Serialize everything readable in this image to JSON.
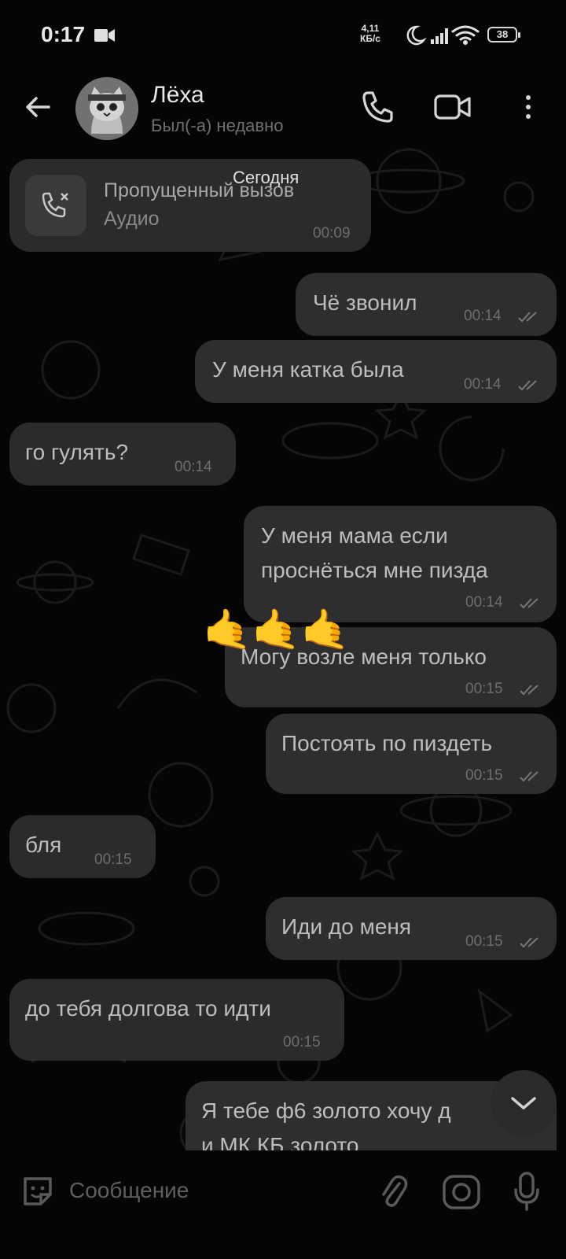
{
  "status_bar": {
    "time": "0:17",
    "net_speed_value": "4,11",
    "net_speed_unit": "КБ/с",
    "battery": "38",
    "icons": [
      "video-camera-icon",
      "moon-icon",
      "signal-icon",
      "wifi-icon",
      "battery-icon"
    ]
  },
  "header": {
    "name": "Лёха",
    "status": "Был(-а) недавно",
    "icons": [
      "back-arrow-icon",
      "phone-icon",
      "video-call-icon",
      "more-vertical-icon"
    ]
  },
  "date_separator": "Сегодня",
  "missed_call": {
    "title": "Пропущенный вызов",
    "subtitle": "Аудио",
    "time": "00:09"
  },
  "messages": [
    {
      "dir": "out",
      "text": "Чё звонил",
      "time": "00:14"
    },
    {
      "dir": "out",
      "text": "У меня катка была",
      "time": "00:14"
    },
    {
      "dir": "in",
      "text": "го гулять?",
      "time": "00:14"
    },
    {
      "dir": "out",
      "lines": [
        "У меня мама если",
        "проснёться мне пизда"
      ],
      "time": "00:14"
    },
    {
      "dir": "out",
      "text": "Могу возле меня только",
      "time": "00:15"
    },
    {
      "dir": "out",
      "text": "Постоять по пиздеть",
      "time": "00:15"
    },
    {
      "dir": "in",
      "text": "бля",
      "time": "00:15"
    },
    {
      "dir": "out",
      "text": "Иди до меня",
      "time": "00:15"
    },
    {
      "dir": "in",
      "text": "до тебя долгова то идти",
      "time": "00:15"
    },
    {
      "dir": "out",
      "lines": [
        "Я тебе ф6 золото хочу д",
        "и МК КБ золото"
      ]
    }
  ],
  "reaction_emoji": "🤙🤙🤙",
  "input": {
    "placeholder": "Сообщение"
  },
  "colors": {
    "background": "#050505",
    "bubble": "#2b2b2b",
    "text": "#bdbdbd",
    "time": "#6e6e6e"
  }
}
